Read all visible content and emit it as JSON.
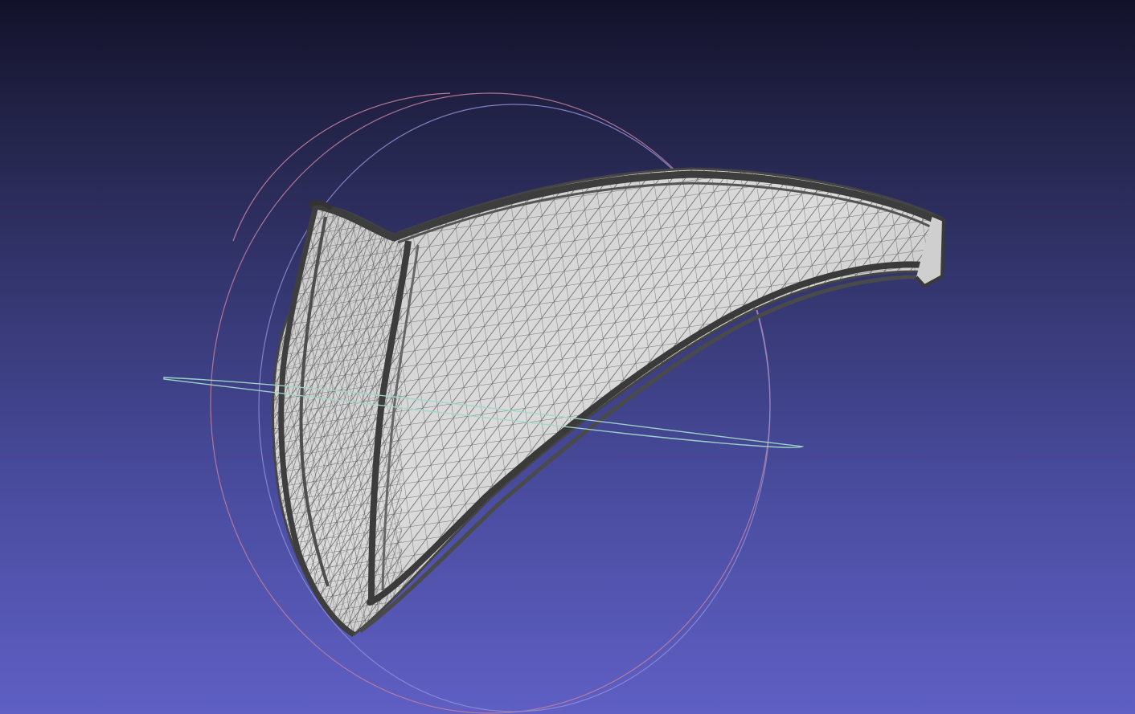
{
  "viewer": {
    "background_top": "#12122a",
    "background_bottom": "#5f5fc4",
    "trackball": {
      "ring_x_color": "#c57f9e",
      "ring_y_color": "#8e8fd6",
      "ring_z_color": "#9fd8c8"
    },
    "mesh": {
      "render_mode": "wireframe-over-flat",
      "fill_color": "#d6d6d6",
      "edge_color": "#4a4a4a"
    }
  }
}
